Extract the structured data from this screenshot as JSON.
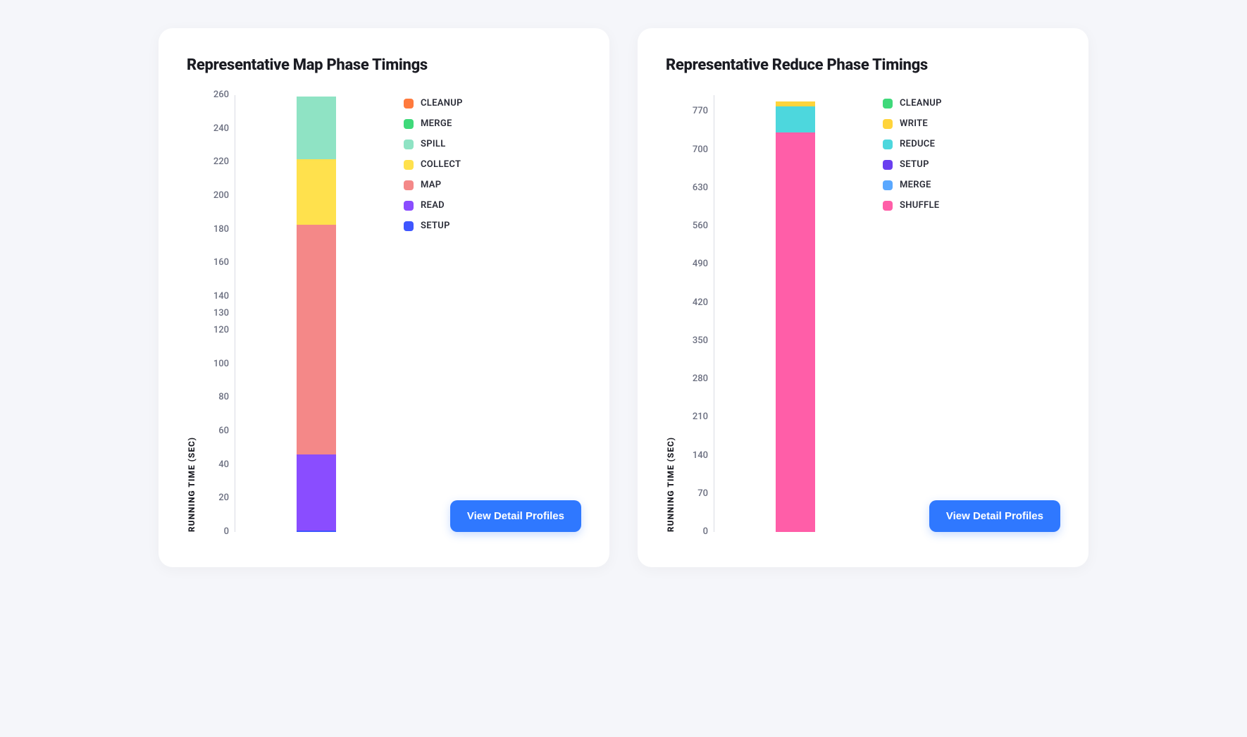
{
  "cards": [
    {
      "title": "Representative Map Phase Timings",
      "ylabel": "RUNNING TIME (SEC)",
      "button_label": "View Detail Profiles",
      "ymax": 260,
      "ticks": [
        260,
        240,
        220,
        200,
        180,
        160,
        140,
        130,
        120,
        100,
        80,
        60,
        40,
        20,
        0
      ]
    },
    {
      "title": "Representative Reduce Phase Timings",
      "ylabel": "RUNNING TIME (SEC)",
      "button_label": "View Detail Profiles",
      "ymax": 800,
      "ticks": [
        770,
        700,
        630,
        560,
        490,
        420,
        350,
        280,
        210,
        140,
        70,
        0
      ]
    }
  ],
  "chart_data": [
    {
      "type": "bar",
      "stacked": true,
      "title": "Representative Map Phase Timings",
      "xlabel": "",
      "ylabel": "RUNNING TIME (SEC)",
      "ylim": [
        0,
        260
      ],
      "categories": [
        ""
      ],
      "series": [
        {
          "name": "SETUP",
          "color": "#3f56ff",
          "values": [
            1
          ]
        },
        {
          "name": "READ",
          "color": "#8a4dff",
          "values": [
            45
          ]
        },
        {
          "name": "MAP",
          "color": "#f48888",
          "values": [
            137
          ]
        },
        {
          "name": "COLLECT",
          "color": "#ffe14d",
          "values": [
            39
          ]
        },
        {
          "name": "SPILL",
          "color": "#8fe3c4",
          "values": [
            37
          ]
        },
        {
          "name": "MERGE",
          "color": "#3fd97a",
          "values": [
            0
          ]
        },
        {
          "name": "CLEANUP",
          "color": "#ff7a3d",
          "values": [
            0
          ]
        }
      ],
      "legend_order": [
        "CLEANUP",
        "MERGE",
        "SPILL",
        "COLLECT",
        "MAP",
        "READ",
        "SETUP"
      ]
    },
    {
      "type": "bar",
      "stacked": true,
      "title": "Representative Reduce Phase Timings",
      "xlabel": "",
      "ylabel": "RUNNING TIME (SEC)",
      "ylim": [
        0,
        800
      ],
      "categories": [
        ""
      ],
      "series": [
        {
          "name": "SHUFFLE",
          "color": "#ff5ea8",
          "values": [
            732
          ]
        },
        {
          "name": "MERGE",
          "color": "#5aa8ff",
          "values": [
            0
          ]
        },
        {
          "name": "SETUP",
          "color": "#6a3ff0",
          "values": [
            0
          ]
        },
        {
          "name": "REDUCE",
          "color": "#4dd7dd",
          "values": [
            48
          ]
        },
        {
          "name": "WRITE",
          "color": "#ffd43b",
          "values": [
            8
          ]
        },
        {
          "name": "CLEANUP",
          "color": "#3fd97a",
          "values": [
            0
          ]
        }
      ],
      "legend_order": [
        "CLEANUP",
        "WRITE",
        "REDUCE",
        "SETUP",
        "MERGE",
        "SHUFFLE"
      ]
    }
  ]
}
